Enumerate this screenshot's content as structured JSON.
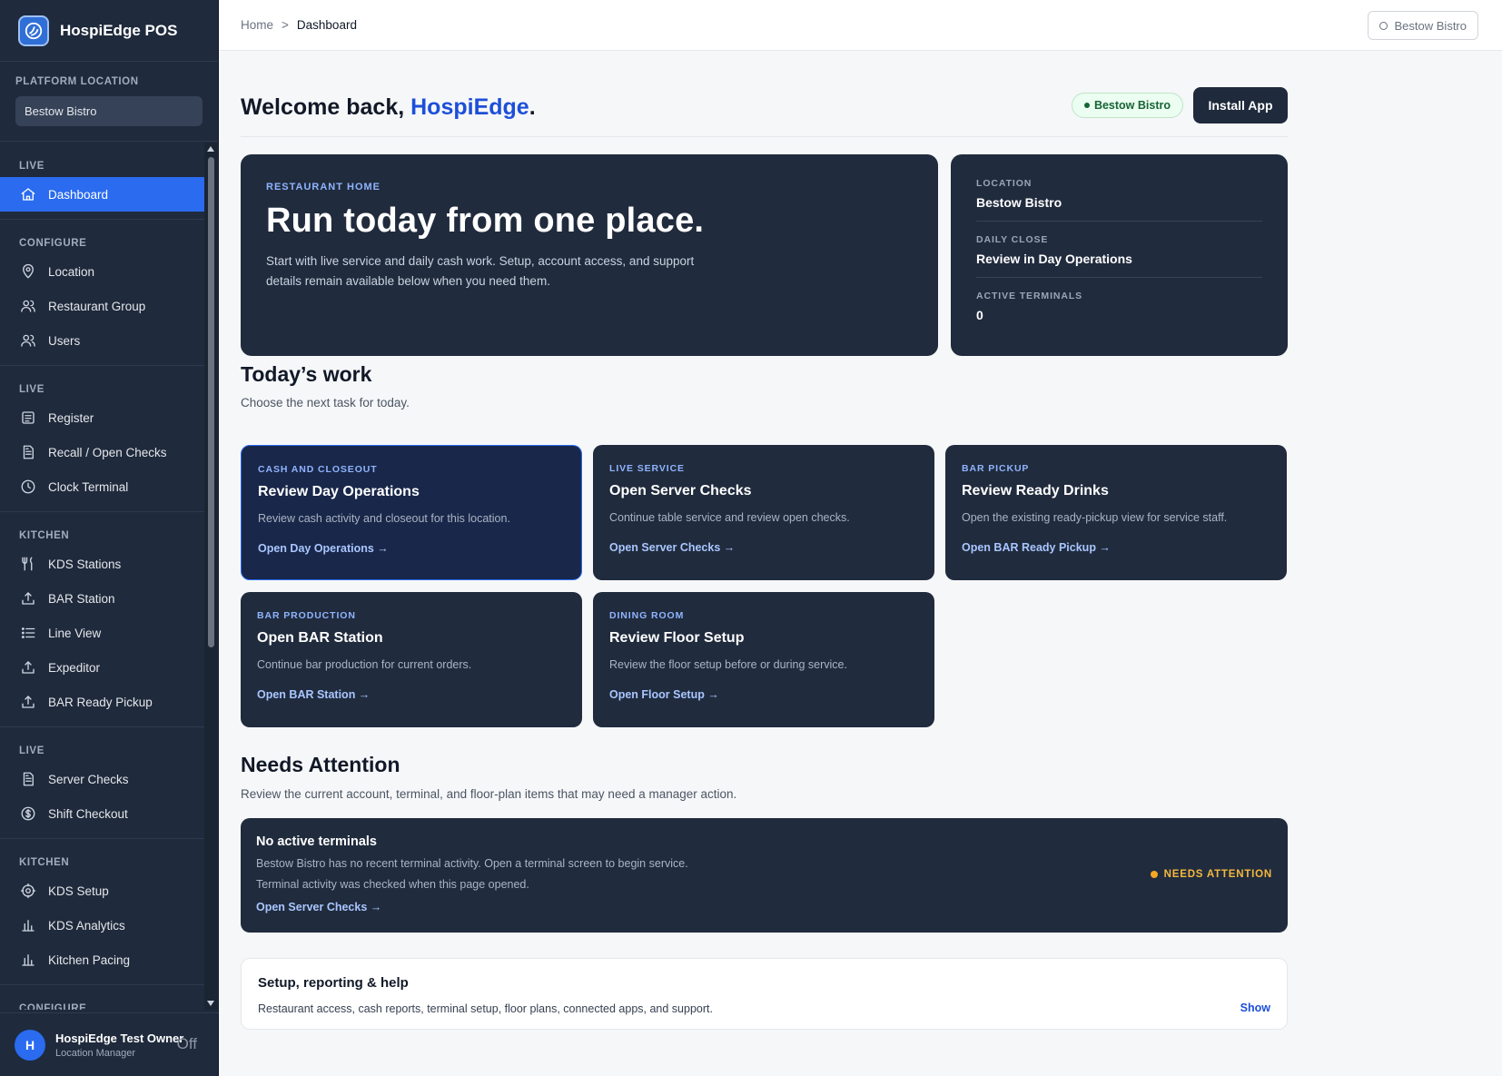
{
  "app": {
    "title": "HospiEdge POS"
  },
  "platform": {
    "label": "PLATFORM LOCATION",
    "value": "Bestow Bistro"
  },
  "sidebar": {
    "sections": [
      {
        "head": "LIVE",
        "items": [
          {
            "label": "Dashboard",
            "icon": "home-icon",
            "active": true
          }
        ]
      },
      {
        "head": "CONFIGURE",
        "items": [
          {
            "label": "Location",
            "icon": "map-pin-icon"
          },
          {
            "label": "Restaurant Group",
            "icon": "users-icon"
          },
          {
            "label": "Users",
            "icon": "users-icon"
          }
        ]
      },
      {
        "head": "LIVE",
        "items": [
          {
            "label": "Register",
            "icon": "register-icon"
          },
          {
            "label": "Recall / Open Checks",
            "icon": "document-icon"
          },
          {
            "label": "Clock Terminal",
            "icon": "clock-icon"
          }
        ]
      },
      {
        "head": "KITCHEN",
        "items": [
          {
            "label": "KDS Stations",
            "icon": "utensils-icon"
          },
          {
            "label": "BAR Station",
            "icon": "upload-tray-icon"
          },
          {
            "label": "Line View",
            "icon": "list-icon"
          },
          {
            "label": "Expeditor",
            "icon": "upload-tray-icon"
          },
          {
            "label": "BAR Ready Pickup",
            "icon": "upload-tray-icon"
          }
        ]
      },
      {
        "head": "LIVE",
        "items": [
          {
            "label": "Server Checks",
            "icon": "document-icon"
          },
          {
            "label": "Shift Checkout",
            "icon": "dollar-icon"
          }
        ]
      },
      {
        "head": "KITCHEN",
        "items": [
          {
            "label": "KDS Setup",
            "icon": "gear-icon"
          },
          {
            "label": "KDS Analytics",
            "icon": "bar-chart-icon"
          },
          {
            "label": "Kitchen Pacing",
            "icon": "bar-chart-icon"
          }
        ]
      },
      {
        "head": "CONFIGURE",
        "items": []
      }
    ]
  },
  "user": {
    "initial": "H",
    "name": "HospiEdge Test Owner",
    "role": "Location Manager",
    "status": "Off"
  },
  "topbar": {
    "crumb_home": "Home",
    "crumb_sep": ">",
    "crumb_current": "Dashboard",
    "location_pill": "Bestow Bistro"
  },
  "welcome": {
    "prefix": "Welcome back, ",
    "name": "HospiEdge",
    "suffix": ".",
    "status_pill": "Bestow Bistro",
    "install_label": "Install App"
  },
  "hero": {
    "eyebrow": "RESTAURANT HOME",
    "title": "Run today from one place.",
    "body": "Start with live service and daily cash work. Setup, account access, and support details remain available below when you need them."
  },
  "facts": [
    {
      "label": "LOCATION",
      "value": "Bestow Bistro"
    },
    {
      "label": "DAILY CLOSE",
      "value": "Review in Day Operations"
    },
    {
      "label": "ACTIVE TERMINALS",
      "value": "0"
    }
  ],
  "todays_work": {
    "title": "Today’s work",
    "subtitle": "Choose the next task for today.",
    "tasks": [
      {
        "eyebrow": "CASH AND CLOSEOUT",
        "title": "Review Day Operations",
        "desc": "Review cash activity and closeout for this location.",
        "link": "Open Day Operations →",
        "selected": true
      },
      {
        "eyebrow": "LIVE SERVICE",
        "title": "Open Server Checks",
        "desc": "Continue table service and review open checks.",
        "link": "Open Server Checks →"
      },
      {
        "eyebrow": "BAR PICKUP",
        "title": "Review Ready Drinks",
        "desc": "Open the existing ready-pickup view for service staff.",
        "link": "Open BAR Ready Pickup →"
      },
      {
        "eyebrow": "BAR PRODUCTION",
        "title": "Open BAR Station",
        "desc": "Continue bar production for current orders.",
        "link": "Open BAR Station →"
      },
      {
        "eyebrow": "DINING ROOM",
        "title": "Review Floor Setup",
        "desc": "Review the floor setup before or during service.",
        "link": "Open Floor Setup →"
      }
    ]
  },
  "needs_attention": {
    "title": "Needs Attention",
    "subtitle": "Review the current account, terminal, and floor-plan items that may need a manager action.",
    "card": {
      "title": "No active terminals",
      "line1": "Bestow Bistro has no recent terminal activity. Open a terminal screen to begin service.",
      "line2": "Terminal activity was checked when this page opened.",
      "link": "Open Server Checks →",
      "badge": "NEEDS ATTENTION"
    }
  },
  "help": {
    "title": "Setup, reporting & help",
    "desc": "Restaurant access, cash reports, terminal setup, floor plans, connected apps, and support.",
    "show": "Show"
  }
}
